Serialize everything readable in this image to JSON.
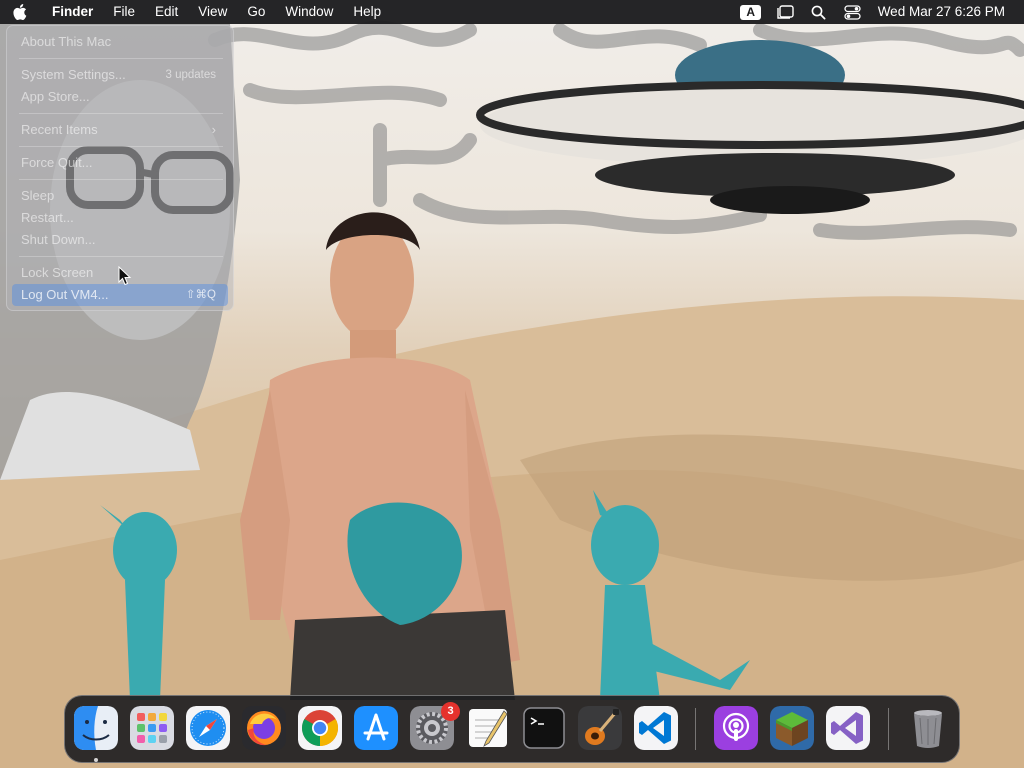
{
  "menubar": {
    "app_name": "Finder",
    "menus": [
      "File",
      "Edit",
      "View",
      "Go",
      "Window",
      "Help"
    ],
    "input_source": "A",
    "clock": "Wed Mar 27  6:26 PM"
  },
  "apple_menu": {
    "items": [
      {
        "label": "About This Mac",
        "shortcut": ""
      },
      {
        "label": "System Settings...",
        "shortcut": "3 updates"
      },
      {
        "label": "App Store...",
        "shortcut": ""
      },
      {
        "label": "Recent Items",
        "shortcut": ""
      },
      {
        "label": "Force Quit...",
        "shortcut": ""
      },
      {
        "label": "Sleep",
        "shortcut": ""
      },
      {
        "label": "Restart...",
        "shortcut": ""
      },
      {
        "label": "Shut Down...",
        "shortcut": ""
      },
      {
        "label": "Lock Screen",
        "shortcut": ""
      },
      {
        "label": "Log Out VM4...",
        "shortcut": "⇧⌘Q"
      }
    ],
    "highlighted_index": 9
  },
  "dock": {
    "items": [
      {
        "name": "Finder",
        "running": true
      },
      {
        "name": "Launchpad",
        "running": false
      },
      {
        "name": "Safari",
        "running": false
      },
      {
        "name": "Firefox",
        "running": false
      },
      {
        "name": "Google Chrome",
        "running": false
      },
      {
        "name": "App Store",
        "running": false
      },
      {
        "name": "System Settings",
        "running": false,
        "badge": "3"
      },
      {
        "name": "TextEdit",
        "running": false
      },
      {
        "name": "Terminal",
        "running": false
      },
      {
        "name": "GarageBand",
        "running": false
      },
      {
        "name": "Visual Studio Code",
        "running": false
      },
      {
        "name": "Podcasts",
        "running": false
      },
      {
        "name": "Minecraft",
        "running": false
      },
      {
        "name": "Visual Studio",
        "running": false
      },
      {
        "name": "Trash",
        "running": false
      }
    ]
  },
  "colors": {
    "menubar_bg": "#1c1c1e",
    "badge": "#e5322d",
    "menu_highlight": "#508ce6"
  }
}
